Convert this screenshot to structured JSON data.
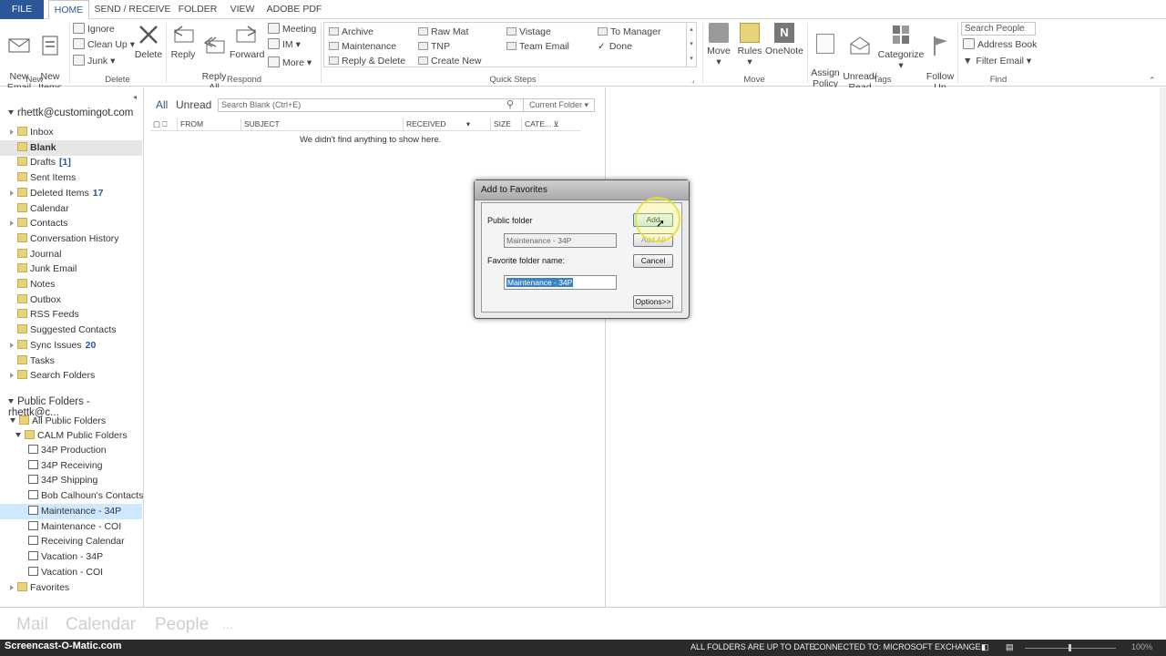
{
  "tabs": [
    "FILE",
    "HOME",
    "SEND / RECEIVE",
    "FOLDER",
    "VIEW",
    "ADOBE PDF"
  ],
  "ribbon": {
    "new": {
      "new_email": "New\nEmail",
      "new_items": "New\nItems",
      "label": "New"
    },
    "delete": {
      "ignore": "Ignore",
      "clean_up": "Clean Up",
      "junk": "Junk",
      "delete": "Delete",
      "label": "Delete"
    },
    "respond": {
      "reply": "Reply",
      "reply_all": "Reply\nAll",
      "forward": "Forward",
      "meeting": "Meeting",
      "im": "IM",
      "more": "More",
      "label": "Respond"
    },
    "quick_steps": {
      "items": [
        "Archive",
        "Maintenance",
        "Reply & Delete",
        "Raw Mat",
        "TNP",
        "Create New",
        "Vistage",
        "Team Email",
        "To Manager",
        "Done"
      ],
      "label": "Quick Steps"
    },
    "move": {
      "move": "Move",
      "rules": "Rules",
      "onenote": "OneNote",
      "label": "Move"
    },
    "tags": {
      "assign_policy": "Assign\nPolicy",
      "unread_read": "Unread/\nRead",
      "categorize": "Categorize",
      "follow_up": "Follow\nUp",
      "label": "Tags"
    },
    "find": {
      "search_people": "Search People",
      "address_book": "Address Book",
      "filter_email": "Filter Email",
      "label": "Find"
    }
  },
  "nav": {
    "account": "rhettk@customingot.com",
    "folders": [
      {
        "name": "Inbox",
        "count": ""
      },
      {
        "name": "Blank",
        "count": ""
      },
      {
        "name": "Drafts",
        "count": "[1]"
      },
      {
        "name": "Sent Items",
        "count": ""
      },
      {
        "name": "Deleted Items",
        "count": "17"
      },
      {
        "name": "Calendar",
        "count": ""
      },
      {
        "name": "Contacts",
        "count": ""
      },
      {
        "name": "Conversation History",
        "count": ""
      },
      {
        "name": "Journal",
        "count": ""
      },
      {
        "name": "Junk Email",
        "count": ""
      },
      {
        "name": "Notes",
        "count": ""
      },
      {
        "name": "Outbox",
        "count": ""
      },
      {
        "name": "RSS Feeds",
        "count": ""
      },
      {
        "name": "Suggested Contacts",
        "count": ""
      },
      {
        "name": "Sync Issues",
        "count": "20"
      },
      {
        "name": "Tasks",
        "count": ""
      },
      {
        "name": "Search Folders",
        "count": ""
      }
    ],
    "public_header": "Public Folders - rhettk@c...",
    "all_public": "All Public Folders",
    "calm": "CALM Public Folders",
    "public_folders": [
      "34P Production",
      "34P Receiving",
      "34P Shipping",
      "Bob Calhoun's Contacts",
      "Maintenance - 34P",
      "Maintenance - COI",
      "Receiving Calendar",
      "Vacation - 34P",
      "Vacation - COI"
    ],
    "favorites": "Favorites"
  },
  "list": {
    "filter_all": "All",
    "filter_unread": "Unread",
    "search_placeholder": "Search Blank (Ctrl+E)",
    "scope": "Current Folder",
    "columns": [
      "FROM",
      "SUBJECT",
      "RECEIVED",
      "SIZE",
      "CATE..."
    ],
    "empty_msg": "We didn't find anything to show here."
  },
  "dialog": {
    "title": "Add to Favorites",
    "public_folder_label": "Public folder",
    "public_folder_value": "Maintenance - 34P",
    "favorite_label": "Favorite folder name:",
    "favorite_value": "Maintenance - 34P",
    "add": "Add",
    "add_all": "Add All",
    "cancel": "Cancel",
    "options": "Options>>"
  },
  "bottom_nav": [
    "Mail",
    "Calendar",
    "People",
    "..."
  ],
  "status": {
    "folders_status": "ALL FOLDERS ARE UP TO DATE.",
    "connection": "CONNECTED TO: MICROSOFT EXCHANGE",
    "zoom": "100%"
  },
  "watermark": "Screencast-O-Matic.com"
}
